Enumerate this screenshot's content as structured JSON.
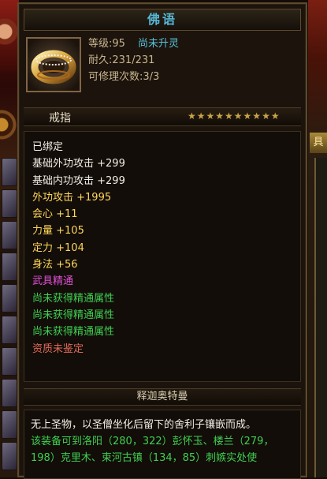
{
  "item": {
    "title": "佛语",
    "level_text": "等级:95",
    "spirit_status": "尚未升灵",
    "durability_text": "耐久:231/231",
    "repair_text": "可修理次数:3/3",
    "type_label": "戒指",
    "star_count": 10,
    "stars": "★★★★★★★★★★",
    "icon": "gold-ring-icon"
  },
  "attributes": [
    {
      "text": "已绑定",
      "color": "white"
    },
    {
      "text": "基础外功攻击 +299",
      "color": "white"
    },
    {
      "text": "基础内功攻击 +299",
      "color": "white"
    },
    {
      "text": "外功攻击 +1995",
      "color": "gold"
    },
    {
      "text": "会心 +11",
      "color": "gold"
    },
    {
      "text": "力量 +105",
      "color": "gold"
    },
    {
      "text": "定力 +104",
      "color": "gold"
    },
    {
      "text": "身法 +56",
      "color": "gold"
    },
    {
      "text": "武具精通",
      "color": "pink"
    },
    {
      "text": "尚未获得精通属性",
      "color": "green"
    },
    {
      "text": "尚未获得精通属性",
      "color": "green"
    },
    {
      "text": "尚未获得精通属性",
      "color": "green"
    },
    {
      "text": "资质未鉴定",
      "color": "red"
    }
  ],
  "origin_name": "释迦奥特曼",
  "description": {
    "lore": "无上圣物，以圣僧坐化后留下的舍利子镶嵌而成。",
    "location": "该装备可到洛阳（280，322）彭怀玉、楼兰（279，198）克里木、束河古镇（134，85）刺嫉实处使"
  },
  "colors": {
    "white": "#f2efe6",
    "gold": "#ffd65a",
    "pink": "#e24fd8",
    "green": "#3fcf52",
    "red": "#e46a5a",
    "title": "#56b8d6"
  }
}
